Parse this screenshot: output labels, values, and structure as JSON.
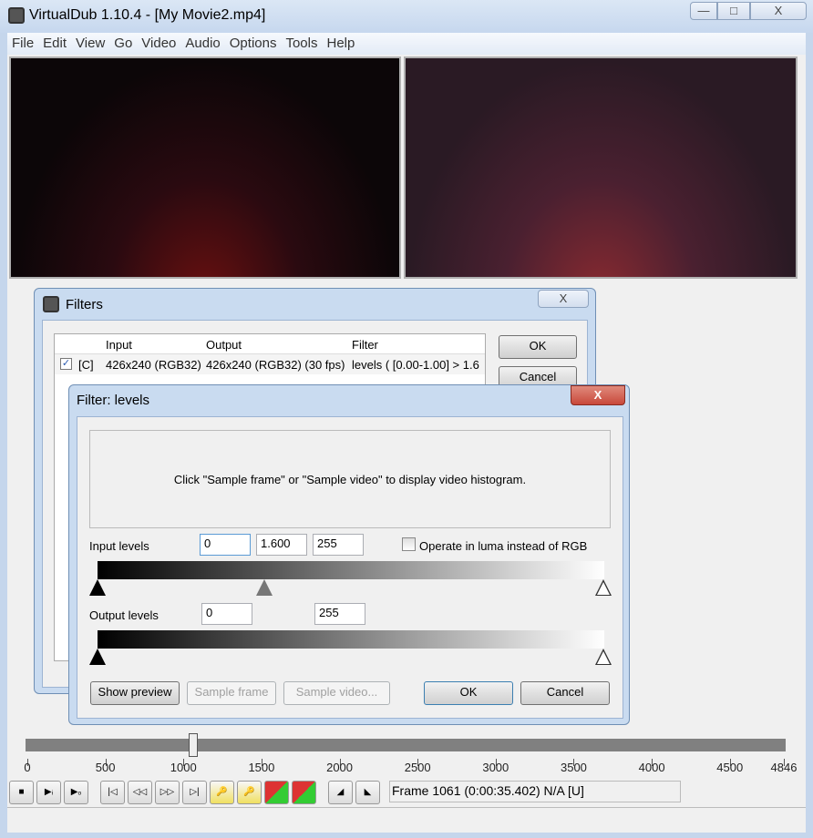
{
  "window": {
    "title": "VirtualDub 1.10.4 - [My Movie2.mp4]",
    "minimize": "—",
    "maximize": "□",
    "close": "X"
  },
  "menu": [
    "File",
    "Edit",
    "View",
    "Go",
    "Video",
    "Audio",
    "Options",
    "Tools",
    "Help"
  ],
  "filters_dialog": {
    "title": "Filters",
    "close": "X",
    "columns": [
      "Input",
      "Output",
      "Filter"
    ],
    "row": {
      "checked": true,
      "flag": "[C]",
      "input": "426x240 (RGB32)",
      "output": "426x240 (RGB32) (30 fps)",
      "filter": "levels ( [0.00-1.00] > 1.6"
    },
    "ok": "OK",
    "cancel": "Cancel"
  },
  "levels_dialog": {
    "title": "Filter: levels",
    "close": "X",
    "histogram_message": "Click \"Sample frame\" or \"Sample video\" to display video histogram.",
    "input_label": "Input levels",
    "input_low": "0",
    "input_gamma": "1.600",
    "input_high": "255",
    "luma_label": "Operate in luma instead of RGB",
    "luma_checked": false,
    "output_label": "Output levels",
    "output_low": "0",
    "output_high": "255",
    "show_preview": "Show preview",
    "sample_frame": "Sample frame",
    "sample_video": "Sample video...",
    "ok": "OK",
    "cancel": "Cancel"
  },
  "timeline": {
    "current_frame": 1061,
    "max_frame": 4846,
    "ticks": [
      "0",
      "500",
      "1000",
      "1500",
      "2000",
      "2500",
      "3000",
      "3500",
      "4000",
      "4500",
      "4846"
    ]
  },
  "status": "Frame 1061 (0:00:35.402) N/A [U]",
  "colors": {
    "frame": "#c5d6ec",
    "client": "#f0f0f0",
    "close_red": "#c8483a"
  }
}
